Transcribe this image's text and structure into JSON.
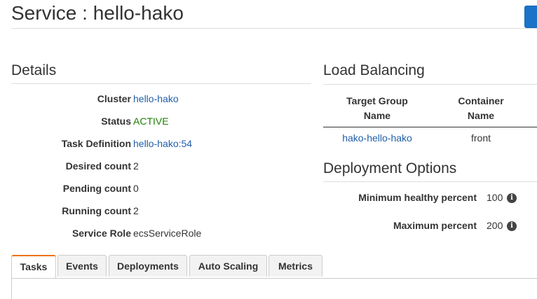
{
  "header": {
    "title": "Service : hello-hako"
  },
  "details": {
    "heading": "Details",
    "rows": [
      {
        "label": "Cluster",
        "value": "hello-hako"
      },
      {
        "label": "Status",
        "value": "ACTIVE"
      },
      {
        "label": "Task Definition",
        "value": "hello-hako:54"
      },
      {
        "label": "Desired count",
        "value": "2"
      },
      {
        "label": "Pending count",
        "value": "0"
      },
      {
        "label": "Running count",
        "value": "2"
      },
      {
        "label": "Service Role",
        "value": "ecsServiceRole"
      }
    ]
  },
  "load_balancing": {
    "heading": "Load Balancing",
    "columns": [
      "Target Group Name",
      "Container Name"
    ],
    "column_lines": [
      [
        "Target Group",
        "Name"
      ],
      [
        "Container",
        "Name"
      ]
    ],
    "rows": [
      [
        "hako-hello-hako",
        "front"
      ]
    ]
  },
  "deployment_options": {
    "heading": "Deployment Options",
    "rows": [
      {
        "label": "Minimum healthy percent",
        "value": "100"
      },
      {
        "label": "Maximum percent",
        "value": "200"
      }
    ]
  },
  "tabs": [
    {
      "label": "Tasks",
      "active": true
    },
    {
      "label": "Events",
      "active": false
    },
    {
      "label": "Deployments",
      "active": false
    },
    {
      "label": "Auto Scaling",
      "active": false
    },
    {
      "label": "Metrics",
      "active": false
    }
  ],
  "icons": {
    "info": "info-icon"
  },
  "colors": {
    "link": "#1f5fa8",
    "status_active": "#1d8102",
    "tab_active_accent": "#ec7211",
    "primary_button": "#1a73c9"
  }
}
